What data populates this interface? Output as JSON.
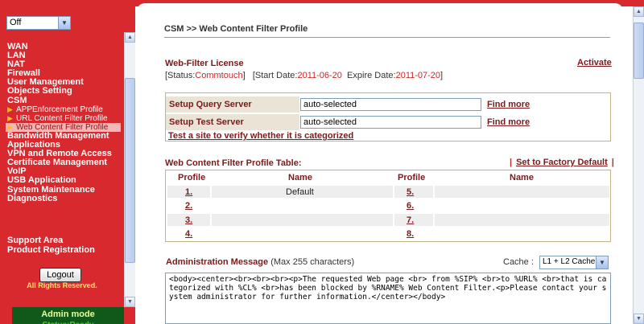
{
  "sidebar": {
    "mode_select": {
      "value": "Off",
      "icon": "chevron-down-icon"
    },
    "menu": [
      "WAN",
      "LAN",
      "NAT",
      "Firewall",
      "User Management",
      "Objects Setting",
      "CSM"
    ],
    "csm_submenu": [
      "APPEnforcement Profile",
      "URL Content Filter Profile",
      "Web Content Filter Profile"
    ],
    "menu2": [
      "Bandwidth Management",
      "Applications",
      "VPN and Remote Access",
      "Certificate Management",
      "VoIP",
      "USB Application",
      "System Maintenance",
      "Diagnostics"
    ],
    "support": [
      "Support Area",
      "Product Registration"
    ],
    "logout": "Logout",
    "rights": "All Rights Reserved.",
    "status": {
      "mode": "Admin mode",
      "state": "Status:Ready"
    }
  },
  "main": {
    "title": "CSM >> Web Content Filter Profile",
    "license": {
      "title": "Web-Filter License",
      "activate": "Activate",
      "status_prefix": "[Status:",
      "status_value": "Commtouch",
      "status_suffix": "]",
      "start_prefix": "[Start Date:",
      "start_value": "2011-06-20",
      "expire_prefix": "Expire Date:",
      "expire_value": "2011-07-20",
      "end_suffix": "]"
    },
    "servers": {
      "query_label": "Setup Query Server",
      "query_value": "auto-selected",
      "test_label": "Setup Test Server",
      "test_value": "auto-selected",
      "find_more": "Find more",
      "test_link": "Test a site to verify whether it is categorized"
    },
    "profile_table": {
      "title": "Web Content Filter Profile Table:",
      "factory": "Set to Factory Default",
      "sep": "|",
      "headers": {
        "profile": "Profile",
        "name": "Name"
      },
      "left": [
        {
          "num": "1.",
          "name": "Default"
        },
        {
          "num": "2.",
          "name": ""
        },
        {
          "num": "3.",
          "name": ""
        },
        {
          "num": "4.",
          "name": ""
        }
      ],
      "right": [
        {
          "num": "5.",
          "name": ""
        },
        {
          "num": "6.",
          "name": ""
        },
        {
          "num": "7.",
          "name": ""
        },
        {
          "num": "8.",
          "name": ""
        }
      ]
    },
    "admin": {
      "title": "Administration Message",
      "subtitle": "(Max 255 characters)",
      "cache_label": "Cache :",
      "cache_value": "L1 + L2 Cache",
      "message": "<body><center><br><br><br><p>The requested Web page <br> from %SIP% <br>to %URL% <br>that is categorized with %CL% <br>has been blocked by %RNAME% Web Content Filter.<p>Please contact your system administrator for further information.</center></body>"
    }
  }
}
